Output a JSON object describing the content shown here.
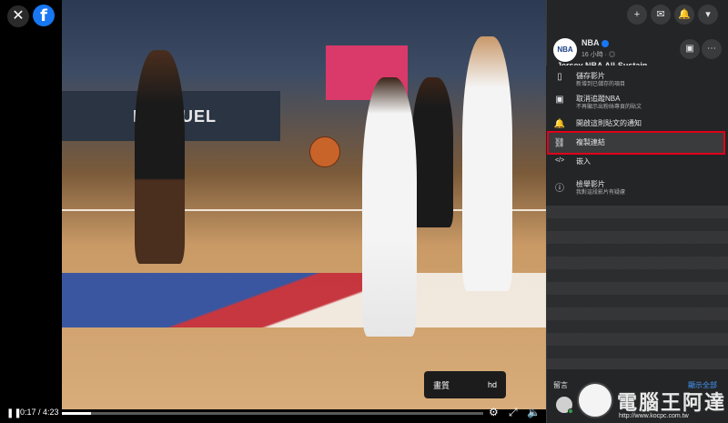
{
  "video": {
    "ad_text": "FANDUEL",
    "quality_label": "畫質",
    "quality_value": "hd",
    "time": "0:17 / 4:23",
    "progress": 0.07
  },
  "page": {
    "name": "NBA",
    "time": "16 小時 · ",
    "title_peek": "Jersey NBA All-Sustain"
  },
  "menu": [
    {
      "icon": "bookmark-icon",
      "label": "儲存影片",
      "sub": "新增到已儲存的項目",
      "glyph": "▯"
    },
    {
      "icon": "unfollow-icon",
      "label": "取消追蹤NBA",
      "sub": "不再顯示出粉絲專頁的貼文",
      "glyph": "▣"
    },
    {
      "icon": "bell-icon",
      "label": "開啟這則貼文的通知",
      "sub": "",
      "glyph": "🔔"
    },
    {
      "icon": "link-icon",
      "label": "複製連結",
      "sub": "",
      "glyph": "⛓"
    },
    {
      "icon": "embed-icon",
      "label": "嵌入",
      "sub": "",
      "glyph": "</>"
    },
    {
      "icon": "report-icon",
      "label": "檢舉影片",
      "sub": "我對這段影片有疑慮",
      "glyph": "ⓘ"
    }
  ],
  "comments": {
    "header": "留言",
    "show_all": "顯示全部"
  },
  "watermark": {
    "text": "電腦王阿達",
    "url": "http://www.kocpc.com.tw"
  },
  "colors": {
    "panel_bg": "#242526",
    "highlight_border": "#e0001a",
    "fb_blue": "#1877f2"
  }
}
